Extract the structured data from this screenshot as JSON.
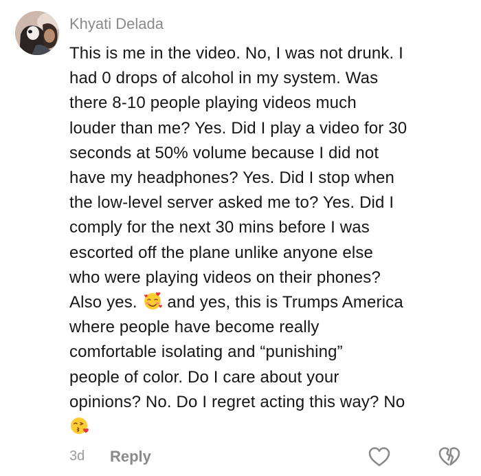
{
  "comment": {
    "author": "Khyati Delada",
    "lines": [
      "This is me in the video. No, I was not drunk. I",
      "had 0 drops of alcohol in my system. Was",
      "there 8-10 people playing videos much",
      "louder than me? Yes. Did I play a video for 30",
      "seconds at 50% volume because I did not",
      "have my headphones? Yes. Did I stop when",
      "the low-level server asked me to? Yes. Did I",
      "comply for the next 30 mins before I was",
      "escorted off the plane unlike anyone else",
      "who were playing videos on their phones?",
      "where people have become really",
      "comfortable isolating and “punishing”",
      "people of color. Do I care about your",
      "opinions? No. Do I regret acting this way? No"
    ],
    "line11_before_emoji": "Also yes.",
    "line11_after_emoji": "and yes, this is Trumps America",
    "emojis": [
      "smiling-face-with-hearts",
      "face-blowing-a-kiss"
    ]
  },
  "footer": {
    "age": "3d",
    "reply_label": "Reply"
  },
  "icons": {
    "like": "heart-outline-icon",
    "dislike": "broken-heart-outline-icon"
  },
  "colors": {
    "author": "#8a8a8a",
    "body_text": "#161616",
    "muted": "#9b9b9b",
    "icon": "#8a8a8a"
  }
}
